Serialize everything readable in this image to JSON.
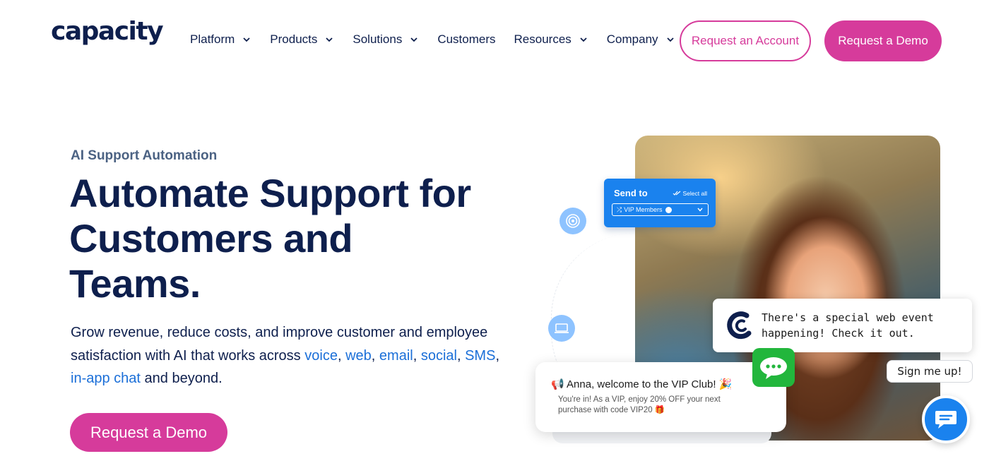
{
  "header": {
    "logo": "capacity",
    "nav": [
      {
        "label": "Platform",
        "has_dropdown": true
      },
      {
        "label": "Products",
        "has_dropdown": true
      },
      {
        "label": "Solutions",
        "has_dropdown": true
      },
      {
        "label": "Customers",
        "has_dropdown": false
      },
      {
        "label": "Resources",
        "has_dropdown": true
      },
      {
        "label": "Company",
        "has_dropdown": true
      }
    ],
    "request_account_label": "Request an Account",
    "request_demo_label": "Request a Demo"
  },
  "hero": {
    "eyebrow": "AI Support Automation",
    "headline_line1": "Automate Support for",
    "headline_line2": "Customers and",
    "headline_line3": "Teams.",
    "desc_part1": "Grow revenue, reduce costs, and improve customer and employee satisfaction with AI that works across ",
    "links": {
      "voice": "voice",
      "web": "web",
      "email": "email",
      "social": "social",
      "sms": "SMS",
      "inapp": "in-app chat"
    },
    "sep_comma": ", ",
    "desc_end": " and beyond.",
    "cta_label": "Request a Demo"
  },
  "visual": {
    "send_card": {
      "title": "Send to",
      "select_all": "Select all",
      "segment": "VIP Members"
    },
    "welcome": {
      "title": "Anna, welcome to the VIP Club!",
      "body": "You're in! As a VIP, enjoy 20% OFF your next purchase with code VIP20"
    }
  },
  "chat_widget": {
    "message": "There's a special web event happening! Check it out.",
    "sign_up_label": "Sign me up!"
  },
  "colors": {
    "brand_navy": "#0e1f4d",
    "brand_pink": "#d63b9b",
    "link_blue": "#1b6fd8",
    "widget_blue": "#1a82ee",
    "line_green": "#22b63c"
  }
}
